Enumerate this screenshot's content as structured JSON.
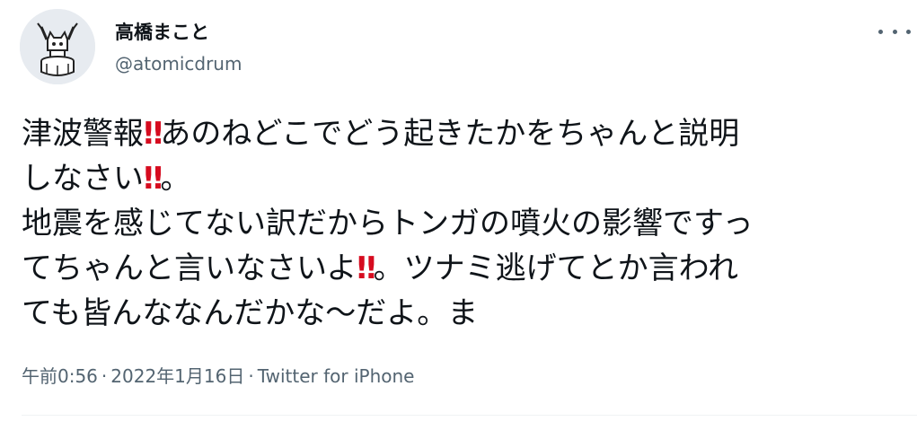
{
  "author": {
    "display_name": "高橋まこと",
    "handle": "@atomicdrum"
  },
  "tweet": {
    "lines": [
      [
        {
          "text": "津波警報"
        },
        {
          "text": "‼",
          "emoji": "double-exclamation"
        },
        {
          "text": "あのねどこでどう起きたかをちゃんと説明"
        }
      ],
      [
        {
          "text": "しなさい"
        },
        {
          "text": "‼",
          "emoji": "double-exclamation"
        },
        {
          "text": "。"
        }
      ],
      [
        {
          "text": "地震を感じてない訳だからトンガの噴火の影響ですっ"
        }
      ],
      [
        {
          "text": "てちゃんと言いなさいよ"
        },
        {
          "text": "‼",
          "emoji": "double-exclamation"
        },
        {
          "text": "。ツナミ逃げてとか言われ"
        }
      ],
      [
        {
          "text": "ても皆んななんだかな～だよ。ま"
        }
      ]
    ]
  },
  "meta": {
    "time": "午前0:56",
    "separator": "·",
    "date": "2022年1月16日",
    "source": "Twitter for iPhone"
  },
  "icons": {
    "more": "more-dots-icon",
    "avatar": "avatar-drummer-cat"
  },
  "colors": {
    "text": "#0f1419",
    "secondary": "#536471",
    "emoji_red": "#d60b1f"
  }
}
